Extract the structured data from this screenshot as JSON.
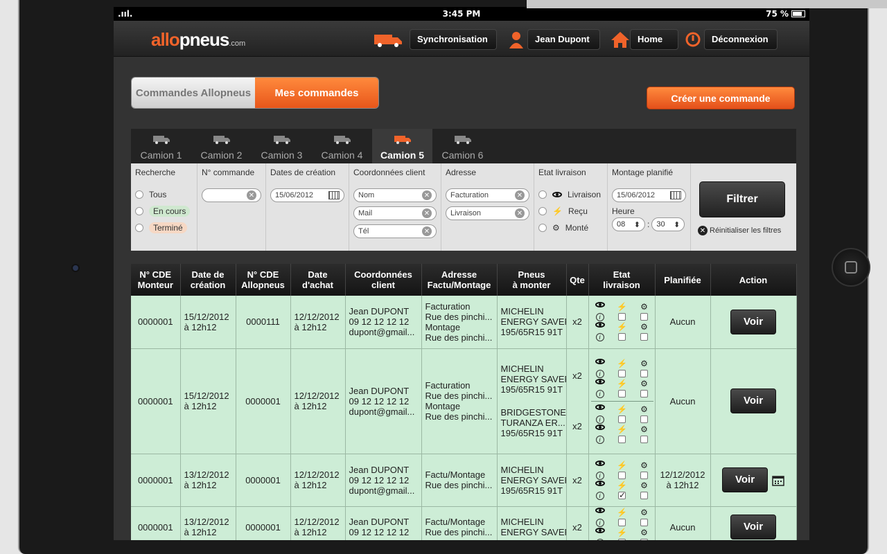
{
  "status": {
    "signal": ".ııl.",
    "time": "3:45 PM",
    "battery": "75 %"
  },
  "header": {
    "logo_prefix": "allo",
    "logo_main": "pneus",
    "logo_suffix": ".com",
    "sync_label": "Synchronisation",
    "user_label": "Jean Dupont",
    "home_label": "Home",
    "logout_label": "Déconnexion"
  },
  "segments": {
    "left": "Commandes Allopneus",
    "right": "Mes commandes"
  },
  "create_label": "Créer une commande",
  "tabs": [
    "Camion 1",
    "Camion 2",
    "Camion 3",
    "Camion 4",
    "Camion 5",
    "Camion 6"
  ],
  "filters": {
    "recherche": {
      "title": "Recherche",
      "options": [
        "Tous",
        "En cours",
        "Terminé"
      ]
    },
    "commande": {
      "title": "N° commande",
      "value": ""
    },
    "dates": {
      "title": "Dates de création",
      "value": "15/06/2012"
    },
    "coord": {
      "title": "Coordonnées client",
      "nom": "Nom",
      "mail": "Mail",
      "tel": "Tél"
    },
    "adresse": {
      "title": "Adresse",
      "facturation": "Facturation",
      "livraison": "Livraison"
    },
    "etat": {
      "title": "Etat livraison",
      "options": [
        "Livraison",
        "Reçu",
        "Monté"
      ]
    },
    "montage": {
      "title": "Montage planifié",
      "date": "15/06/2012",
      "heure_label": "Heure",
      "hour": "08",
      "minute": "30",
      "colon": ":"
    },
    "filtrer": "Filtrer",
    "reset": "Réinitialiser les filtres"
  },
  "table": {
    "headers": [
      [
        "N° CDE",
        "Monteur"
      ],
      [
        "Date de",
        "création"
      ],
      [
        "N° CDE",
        "Allopneus"
      ],
      [
        "Date",
        "d'achat"
      ],
      [
        "Coordonnées",
        "client"
      ],
      [
        "Adresse",
        "Factu/Montage"
      ],
      [
        "Pneus",
        "à monter"
      ],
      [
        "Qte",
        ""
      ],
      [
        "Etat",
        "livraison"
      ],
      [
        "Planifiée",
        ""
      ],
      [
        "Action",
        ""
      ]
    ],
    "rows": [
      {
        "monteur": "0000001",
        "creation1": "15/12/2012",
        "creation2": "à 12h12",
        "allopneus": "0000111",
        "achat1": "12/12/2012",
        "achat2": "à 12h12",
        "client": [
          "Jean DUPONT",
          "09 12 12 12 12",
          "dupont@gmail..."
        ],
        "adresse": [
          "Facturation",
          "Rue des pinchi...",
          "Montage",
          "Rue des pinchi..."
        ],
        "pneus": [
          [
            "MICHELIN",
            "ENERGY SAVER",
            "195/65R15 91T"
          ]
        ],
        "qte": [
          "x2"
        ],
        "planifiee": [
          "Aucun"
        ],
        "action": "Voir"
      },
      {
        "monteur": "0000001",
        "creation1": "15/12/2012",
        "creation2": "à 12h12",
        "allopneus": "0000001",
        "achat1": "12/12/2012",
        "achat2": "à 12h12",
        "client": [
          "Jean DUPONT",
          "09 12 12 12 12",
          "dupont@gmail..."
        ],
        "adresse": [
          "Facturation",
          "Rue des pinchi...",
          "Montage",
          "Rue des pinchi..."
        ],
        "pneus": [
          [
            "MICHELIN",
            "ENERGY SAVER",
            "195/65R15 91T"
          ],
          [
            "BRIDGESTONE",
            "TURANZA ER...",
            "195/65R15 91T"
          ]
        ],
        "qte": [
          "x2",
          "x2"
        ],
        "planifiee": [
          "Aucun"
        ],
        "action": "Voir"
      },
      {
        "monteur": "0000001",
        "creation1": "13/12/2012",
        "creation2": "à 12h12",
        "allopneus": "0000001",
        "achat1": "12/12/2012",
        "achat2": "à 12h12",
        "client": [
          "Jean DUPONT",
          "09 12 12 12 12",
          "dupont@gmail..."
        ],
        "adresse": [
          "Factu/Montage",
          "Rue des pinchi..."
        ],
        "pneus": [
          [
            "MICHELIN",
            "ENERGY SAVER",
            "195/65R15 91T"
          ]
        ],
        "qte": [
          "x2"
        ],
        "planifiee": [
          "12/12/2012",
          "à 12h12"
        ],
        "action": "Voir"
      },
      {
        "monteur": "0000001",
        "creation1": "13/12/2012",
        "creation2": "à 12h12",
        "allopneus": "0000001",
        "achat1": "12/12/2012",
        "achat2": "à 12h12",
        "client": [
          "Jean DUPONT",
          "09 12 12 12 12"
        ],
        "adresse": [
          "Factu/Montage",
          "Rue des pinchi..."
        ],
        "pneus": [
          [
            "MICHELIN",
            "ENERGY SAVER"
          ]
        ],
        "qte": [
          "x2"
        ],
        "planifiee": [
          "Aucun"
        ],
        "action": "Voir"
      }
    ]
  },
  "colors": {
    "accent": "#f0632a",
    "row_bg": "#cdedd6",
    "header_bg": "#1e1e1e"
  }
}
